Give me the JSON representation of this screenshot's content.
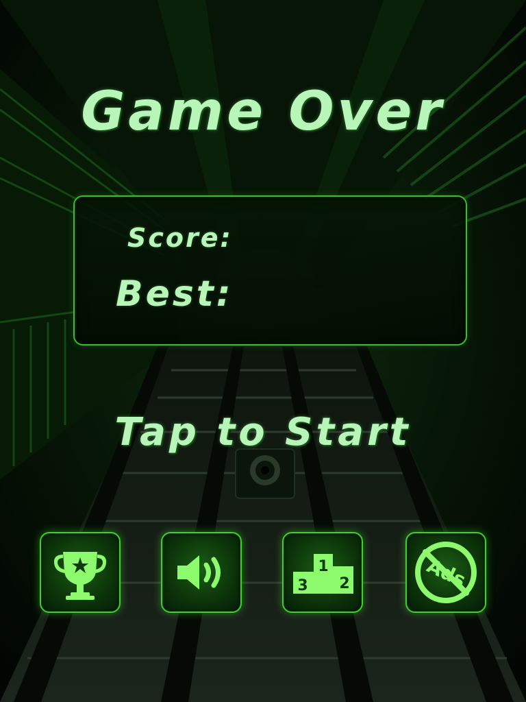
{
  "game": {
    "title": "Game Over",
    "score_label": "Score:",
    "score_value": "",
    "best_label": "Best:",
    "best_value": "",
    "tap_to_start": "Tap to Start"
  },
  "buttons": {
    "achievements_icon": "trophy-icon",
    "sound_icon": "speaker-icon",
    "leaderboard_icon": "podium-icon",
    "remove_ads_icon": "no-ads-icon",
    "remove_ads_text": "Ads",
    "podium_numbers": [
      "1",
      "2",
      "3"
    ]
  },
  "colors": {
    "accent": "#3ed22a",
    "text": "#b8f5b8",
    "icon": "#8dfa6e",
    "background": "#030a03"
  }
}
